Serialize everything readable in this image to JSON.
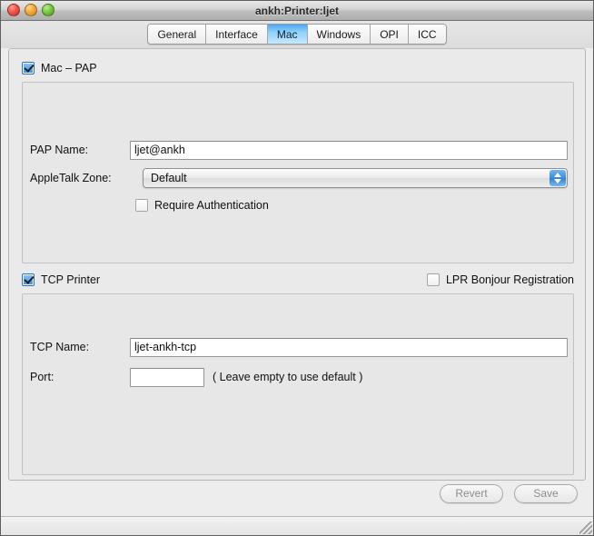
{
  "window": {
    "title": "ankh:Printer:ljet",
    "controls": {
      "close": "close-button",
      "minimize": "minimize-button",
      "zoom": "zoom-button"
    }
  },
  "tabs": [
    {
      "label": "General",
      "selected": false
    },
    {
      "label": "Interface",
      "selected": false
    },
    {
      "label": "Mac",
      "selected": true
    },
    {
      "label": "Windows",
      "selected": false
    },
    {
      "label": "OPI",
      "selected": false
    },
    {
      "label": "ICC",
      "selected": false
    }
  ],
  "mac_pap": {
    "enabled_label": "Mac – PAP",
    "enabled": true,
    "pap_name": {
      "label": "PAP Name:",
      "value": "ljet@ankh"
    },
    "appletalk_zone": {
      "label": "AppleTalk Zone:",
      "value": "Default"
    },
    "require_auth": {
      "label": "Require Authentication",
      "checked": false
    }
  },
  "tcp_printer": {
    "enabled_label": "TCP Printer",
    "enabled": true,
    "lpr_bonjour": {
      "label": "LPR Bonjour Registration",
      "checked": false
    },
    "tcp_name": {
      "label": "TCP Name:",
      "value": "ljet-ankh-tcp"
    },
    "port": {
      "label": "Port:",
      "value": "",
      "hint": "( Leave empty to use default )"
    }
  },
  "footer": {
    "revert_label": "Revert",
    "save_label": "Save"
  },
  "colors": {
    "tab_selected": "#4ea7f4",
    "checkbox_checked": "#3d8fdd",
    "window_bg": "#ededed",
    "panel_bg": "#e7e7e7"
  }
}
